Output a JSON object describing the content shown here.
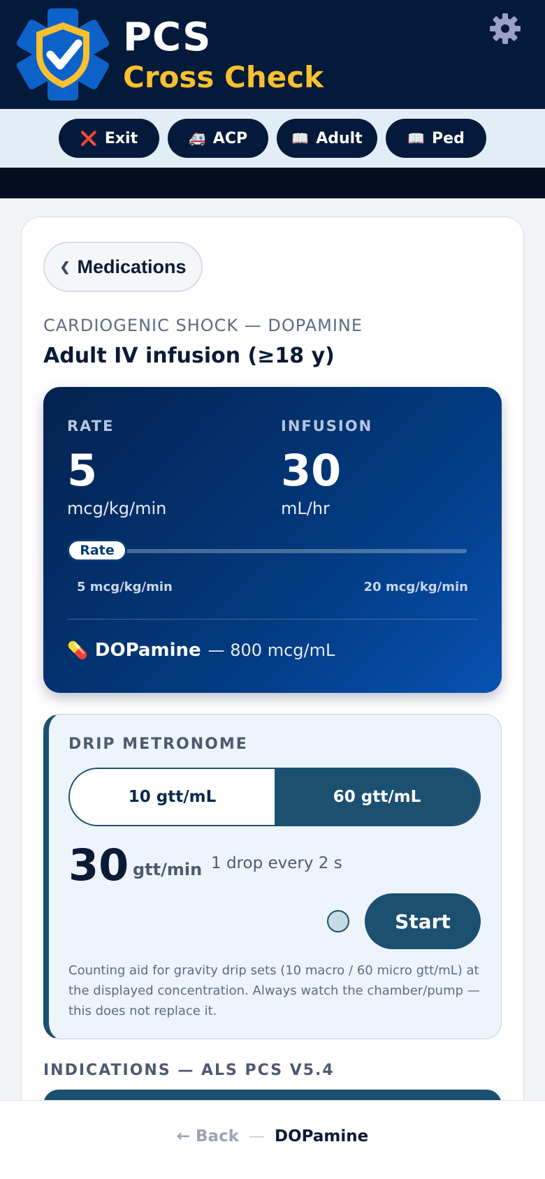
{
  "app": {
    "title": "PCS",
    "subtitle": "Cross Check"
  },
  "nav": {
    "exit": {
      "icon": "❌",
      "label": "Exit"
    },
    "acp": {
      "icon": "🚑",
      "label": "ACP"
    },
    "adult": {
      "icon": "📖",
      "label": "Adult"
    },
    "ped": {
      "icon": "📖",
      "label": "Ped"
    }
  },
  "breadcrumb": {
    "back_label": "Medications",
    "category": "CARDIOGENIC SHOCK — DOPAMINE",
    "title": "Adult IV infusion (≥18 y)"
  },
  "dose": {
    "rate_label": "RATE",
    "rate_value": "5",
    "rate_unit": "mcg/kg/min",
    "infusion_label": "INFUSION",
    "infusion_value": "30",
    "infusion_unit": "mL/hr",
    "slider_label": "Rate",
    "slider_min_label": "5 mcg/kg/min",
    "slider_max_label": "20 mcg/kg/min",
    "slider_level_fraction": 0,
    "drug_icon": "💊",
    "drug_name": "DOPamine",
    "drug_concentration": "— 800 mcg/mL"
  },
  "metronome": {
    "title": "DRIP METRONOME",
    "options": [
      "10 gtt/mL",
      "60 gtt/mL"
    ],
    "selected": "60 gtt/mL",
    "rate_value": "30",
    "rate_unit": "gtt/min",
    "rate_note": "1 drop every 2 s",
    "start_label": "Start",
    "note": "Counting aid for gravity drip sets (10 macro / 60 micro gtt/mL) at the displayed concentration. Always watch the chamber/pump — this does not replace it."
  },
  "indications": {
    "heading": "INDICATIONS — ALS PCS V5.4"
  },
  "footer": {
    "back_label": "← Back",
    "separator": "—",
    "current": "DOPamine"
  },
  "colors": {
    "header_bg": "#031a3b",
    "accent_yellow": "#fbc02d",
    "teal": "#1c5070",
    "dose_gradient_start": "#04224f",
    "dose_gradient_end": "#0752b2"
  }
}
